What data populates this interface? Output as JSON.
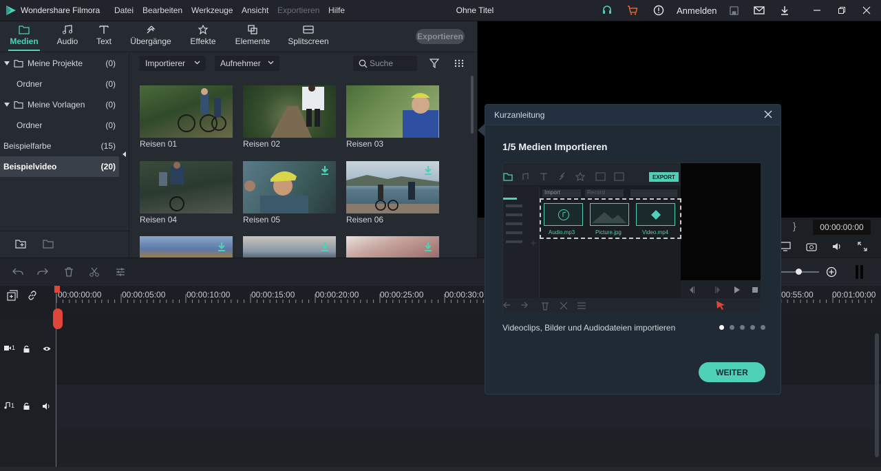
{
  "titlebar": {
    "app_name": "Wondershare Filmora",
    "menu": [
      "Datei",
      "Bearbeiten",
      "Werkzeuge",
      "Ansicht",
      "Exportieren",
      "Hilfe"
    ],
    "doc_title": "Ohne Titel",
    "login": "Anmelden",
    "icons": [
      "headset-icon",
      "cart-icon",
      "info-icon",
      "save-icon",
      "mail-icon",
      "download-icon",
      "minimize-icon",
      "maximize-icon",
      "close-icon"
    ],
    "accent": "#4fd1b8",
    "cart_color": "#e06a2c"
  },
  "tabs": [
    {
      "label": "Medien",
      "icon": "folder-icon",
      "active": true
    },
    {
      "label": "Audio",
      "icon": "music-icon",
      "active": false
    },
    {
      "label": "Text",
      "icon": "text-icon",
      "active": false
    },
    {
      "label": "Übergänge",
      "icon": "transition-icon",
      "active": false
    },
    {
      "label": "Effekte",
      "icon": "effects-icon",
      "active": false
    },
    {
      "label": "Elemente",
      "icon": "elements-icon",
      "active": false
    },
    {
      "label": "Splitscreen",
      "icon": "splitscreen-icon",
      "active": false
    }
  ],
  "export_button": "Exportieren",
  "sidebar": {
    "items": [
      {
        "label": "Meine Projekte",
        "count": "(0)"
      },
      {
        "label": "Ordner",
        "count": "(0)"
      },
      {
        "label": "Meine Vorlagen",
        "count": "(0)"
      },
      {
        "label": "Ordner",
        "count": "(0)"
      },
      {
        "label": "Beispielfarbe",
        "count": "(15)"
      },
      {
        "label": "Beispielvideo",
        "count": "(20)"
      }
    ]
  },
  "media_bar": {
    "import_label": "Importierer",
    "record_label": "Aufnehmer",
    "search_placeholder": "Suche"
  },
  "media": [
    {
      "label": "Reisen 01"
    },
    {
      "label": "Reisen 02"
    },
    {
      "label": "Reisen 03"
    },
    {
      "label": "Reisen 04"
    },
    {
      "label": "Reisen 05"
    },
    {
      "label": "Reisen 06"
    }
  ],
  "preview": {
    "time": "00:00:00:00"
  },
  "timeline": {
    "ticks": [
      "00:00:00:00",
      "00:00:05:00",
      "00:00:10:00",
      "00:00:15:00",
      "00:00:20:00",
      "00:00:25:00",
      "00:00:30:0",
      "00:55:00",
      "00:01:00:00"
    ],
    "video_track": "1",
    "audio_track": "1"
  },
  "guide": {
    "header": "Kurzanleitung",
    "step": "1/5 Medien Importieren",
    "description": "Videoclips, Bilder und Audiodateien importieren",
    "next_button": "WEITER",
    "dots_total": 5,
    "dots_active": 1,
    "illustration": {
      "export": "EXPORT",
      "import": "Import",
      "record": "Record",
      "files": [
        "Audio.mp3",
        "Picture.jpg",
        "Video.mp4"
      ]
    }
  }
}
